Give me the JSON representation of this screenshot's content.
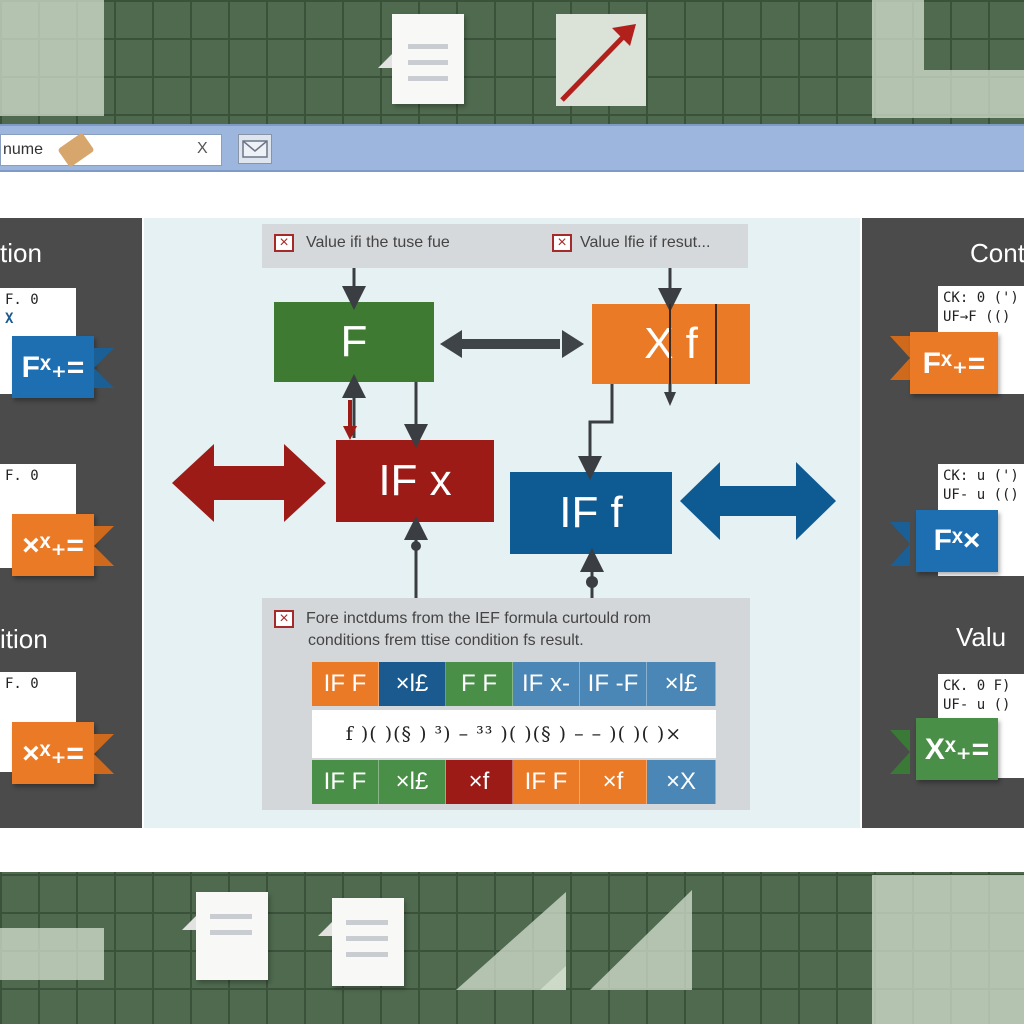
{
  "colors": {
    "green": "#3e7a32",
    "orange": "#ea7a26",
    "red": "#9c1b17",
    "blue": "#0e5a93",
    "cell_blue": "#4a86b6",
    "cell_green": "#4a8f48",
    "cell_navy": "#1b5a8e"
  },
  "icons": [
    "eraser-icon",
    "hourglass-icon",
    "envelope-icon",
    "document-icon",
    "trend-arrow-icon",
    "checkbox-x-icon"
  ],
  "formula_bar": {
    "name_box": "nume",
    "cursor_glyph": "X"
  },
  "left_panel": {
    "titles": [
      "tion",
      "ition"
    ],
    "cards": [
      {
        "line1": "F.  0",
        "line2": "X",
        "line3": ""
      },
      {
        "line1": "F.  0",
        "line2": "",
        "line3": ""
      },
      {
        "line1": "F.  0",
        "line2": "",
        "line3": ""
      }
    ],
    "ribbons": [
      "Fˣ₊=",
      "×ˣ₊=",
      "×ˣ₊="
    ]
  },
  "right_panel": {
    "titles": [
      "Cont",
      "Valu"
    ],
    "cards": [
      {
        "line1": "CK: 0   (')",
        "line2": "UF→F    (()"
      },
      {
        "line1": "CK: u   (')",
        "line2": "UF- u   (()"
      },
      {
        "line1": "CK. 0   F)",
        "line2": "UF- u   ()"
      }
    ],
    "ribbons": [
      "Fˣ₊=",
      "Fˣ×",
      "Xˣ₊="
    ]
  },
  "diagram": {
    "top_labels": [
      "Value ifi the tuse fue",
      "Value lfie if resut..."
    ],
    "nodes": {
      "f_green": "F",
      "xf_orange": "X f",
      "if_red": "IF x",
      "if_blue": "IF f"
    },
    "bottom_text": [
      "Fore inctdums from the IEF formula curtould rom",
      "conditions frem ttise condition fs result."
    ],
    "row1": [
      {
        "label": "IF  F",
        "color": "#ea7a26"
      },
      {
        "label": "×l£",
        "color": "#1b5a8e"
      },
      {
        "label": "F  F",
        "color": "#4a8f48"
      },
      {
        "label": "IF x-",
        "color": "#4a86b6"
      },
      {
        "label": "IF -F",
        "color": "#4a86b6"
      },
      {
        "label": "×l£",
        "color": "#4a86b6"
      }
    ],
    "mid_row": "f )( )(§ ) ³) – ³³ )( )(§ ) – – )( )( )×",
    "row2": [
      {
        "label": "IF  F",
        "color": "#4a8f48"
      },
      {
        "label": "×l£",
        "color": "#4a8f48"
      },
      {
        "label": "×f",
        "color": "#9c1b17"
      },
      {
        "label": "IF  F",
        "color": "#ea7a26"
      },
      {
        "label": "×f",
        "color": "#ea7a26"
      },
      {
        "label": "×X",
        "color": "#4a86b6"
      }
    ]
  }
}
